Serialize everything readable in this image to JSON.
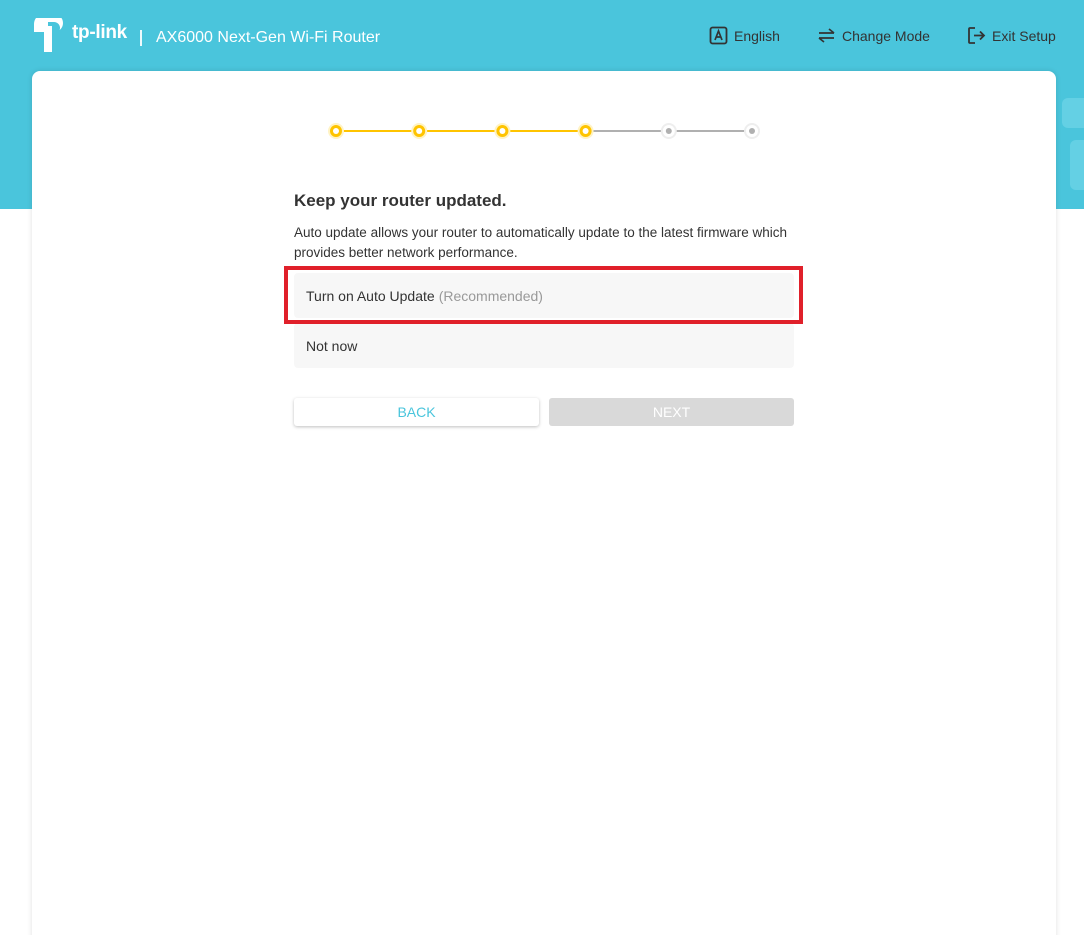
{
  "brand": {
    "logo_text": "tp-link",
    "product_name": "AX6000 Next-Gen Wi-Fi Router"
  },
  "nav": {
    "language": {
      "icon": "language-icon",
      "label": "English"
    },
    "change_mode": {
      "icon": "swap-arrows-icon",
      "label": "Change Mode"
    },
    "exit_setup": {
      "icon": "exit-icon",
      "label": "Exit Setup"
    }
  },
  "stepper": {
    "total_steps": 6,
    "completed_steps": 4
  },
  "page": {
    "title": "Keep your router updated.",
    "description": "Auto update allows your router to automatically update to the latest firmware which provides better network performance."
  },
  "options": [
    {
      "label": "Turn on Auto Update",
      "note": "(Recommended)"
    },
    {
      "label": "Not now",
      "note": ""
    }
  ],
  "buttons": {
    "back": "BACK",
    "next": "NEXT"
  },
  "colors": {
    "banner": "#4ac5dc",
    "step_active": "#ffc400",
    "step_inactive": "#b0b0b0",
    "highlight": "#e0202a",
    "back_text": "#4ac5dc",
    "next_disabled": "#d9d9d9"
  }
}
